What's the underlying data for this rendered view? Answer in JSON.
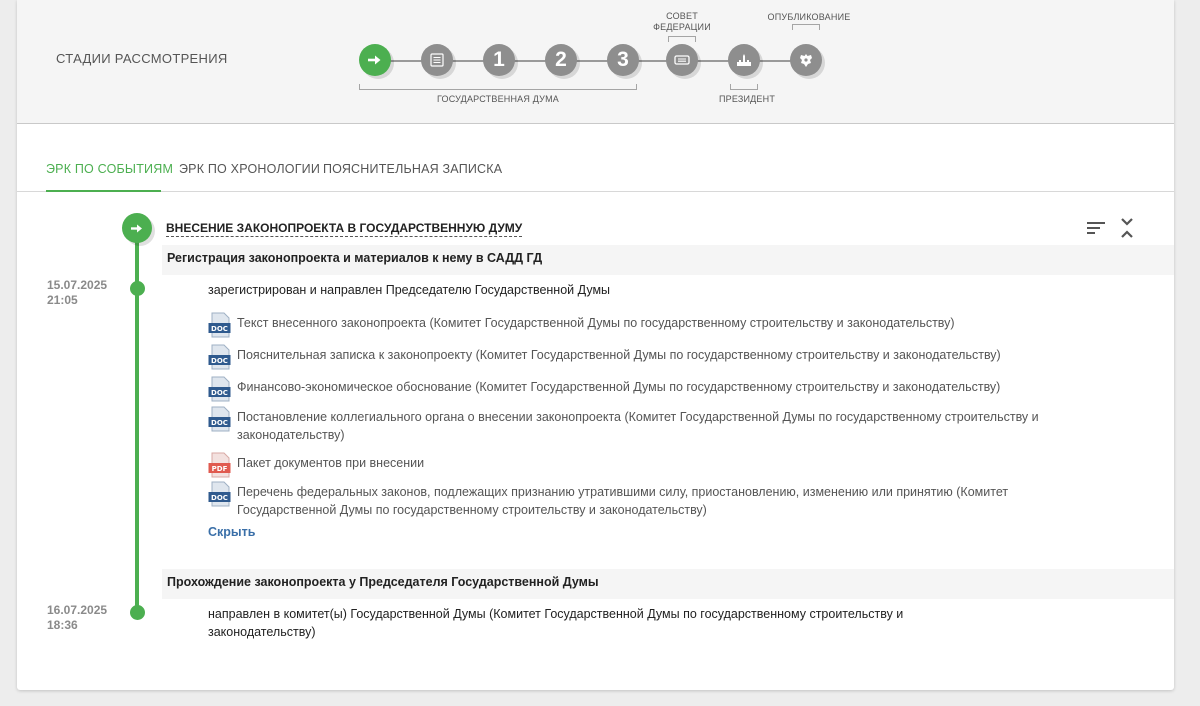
{
  "stages": {
    "title": "СТАДИИ РАССМОТРЕНИЯ",
    "steps": [
      {
        "icon": "arrow-right-icon",
        "active": true
      },
      {
        "icon": "document-icon",
        "active": false
      },
      {
        "label": "1",
        "active": false
      },
      {
        "label": "2",
        "active": false
      },
      {
        "label": "3",
        "active": false
      },
      {
        "icon": "federation-council-icon",
        "active": false
      },
      {
        "icon": "kremlin-icon",
        "active": false
      },
      {
        "icon": "eagle-emblem-icon",
        "active": false
      }
    ],
    "label_duma": "ГОСУДАРСТВЕННАЯ ДУМА",
    "label_council_line1": "СОВЕТ",
    "label_council_line2": "ФЕДЕРАЦИИ",
    "label_president": "ПРЕЗИДЕНТ",
    "label_publication": "ОПУБЛИКОВАНИЕ"
  },
  "tabs": [
    {
      "label": "ЭРК ПО СОБЫТИЯМ",
      "active": true
    },
    {
      "label": "ЭРК ПО ХРОНОЛОГИИ",
      "active": false
    },
    {
      "label": "ПОЯСНИТЕЛЬНАЯ ЗАПИСКА",
      "active": false
    }
  ],
  "timeline": {
    "event_title": "ВНЕСЕНИЕ ЗАКОНОПРОЕКТА В ГОСУДАРСТВЕННУЮ ДУМУ",
    "sections": [
      {
        "title": "Регистрация законопроекта и материалов к нему в САДД ГД",
        "date": "15.07.2025",
        "time": "21:05",
        "action": "зарегистрирован и направлен Председателю Государственной Думы",
        "documents": [
          {
            "type": "DOC",
            "text": "Текст внесенного законопроекта (Комитет Государственной Думы по государственному строительству и законодательству)"
          },
          {
            "type": "DOC",
            "text": "Пояснительная записка к законопроекту (Комитет Государственной Думы по государственному строительству и законодательству)"
          },
          {
            "type": "DOC",
            "text": "Финансово-экономическое обоснование (Комитет Государственной Думы по государственному строительству и законодательству)"
          },
          {
            "type": "DOC",
            "text": "Постановление коллегиального органа о внесении законопроекта (Комитет Государственной Думы по государственному строительству и законодательству)"
          },
          {
            "type": "PDF",
            "text": "Пакет документов при внесении"
          },
          {
            "type": "DOC",
            "text": "Перечень федеральных законов, подлежащих признанию утратившими силу, приостановлению, изменению или принятию (Комитет Государственной Думы по государственному строительству и законодательству)"
          }
        ],
        "hide_label": "Скрыть"
      },
      {
        "title": "Прохождение законопроекта у Председателя Государственной Думы",
        "date": "16.07.2025",
        "time": "18:36",
        "action": "направлен в комитет(ы) Государственной Думы (Комитет Государственной Думы по государственному строительству и законодательству)"
      }
    ]
  },
  "colors": {
    "accent": "#4caf50",
    "stage_inactive": "#8e8e8e",
    "link": "#3a6fa8",
    "doc_icon": "#2f5a8e",
    "pdf_icon": "#e05a4f"
  }
}
